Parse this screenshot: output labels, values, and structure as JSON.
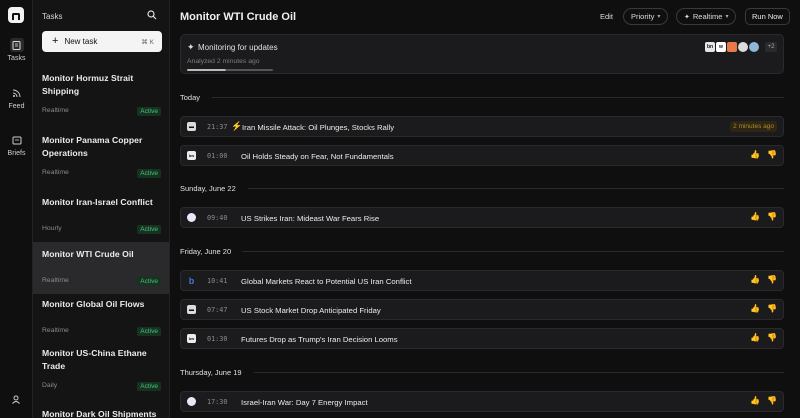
{
  "rail": {
    "items": [
      {
        "label": "Tasks",
        "icon": "clipboard-icon"
      },
      {
        "label": "Feed",
        "icon": "rss-icon"
      },
      {
        "label": "Briefs",
        "icon": "brief-icon"
      },
      {
        "label": "",
        "icon": "user-add-icon"
      }
    ]
  },
  "sidebar": {
    "header": "Tasks",
    "new_task": "New task",
    "shortcut": "⌘ K",
    "tasks": [
      {
        "title": "Monitor Hormuz Strait Shipping",
        "freq": "Realtime",
        "status": "Active"
      },
      {
        "title": "Monitor Panama Copper Operations",
        "freq": "Realtime",
        "status": "Active"
      },
      {
        "title": "Monitor Iran-Israel Conflict",
        "freq": "Hourly",
        "status": "Active"
      },
      {
        "title": "Monitor WTI Crude Oil",
        "freq": "Realtime",
        "status": "Active"
      },
      {
        "title": "Monitor Global Oil Flows",
        "freq": "Realtime",
        "status": "Active"
      },
      {
        "title": "Monitor US-China Ethane Trade",
        "freq": "Daily",
        "status": "Active"
      },
      {
        "title": "Monitor Dark Oil Shipments",
        "freq": "",
        "status": ""
      }
    ]
  },
  "header": {
    "title": "Monitor WTI Crude Oil",
    "edit": "Edit",
    "priority": "Priority",
    "realtime": "Realtime",
    "run_now": "Run Now"
  },
  "monitor": {
    "status": "Monitoring for updates",
    "sub": "Analyzed 2 minutes ago",
    "more": "+2",
    "progress": 0.45
  },
  "feed": {
    "today": "Today",
    "sun": "Sunday, June 22",
    "fri": "Friday, June 20",
    "thu": "Thursday, June 19",
    "rows": [
      {
        "time": "21:37",
        "title": "Iran Missile Attack: Oil Plunges, Stocks Rally",
        "tag": "2 minutes ago"
      },
      {
        "time": "01:00",
        "title": "Oil Holds Steady on Fear, Not Fundamentals"
      },
      {
        "time": "09:40",
        "title": "US Strikes Iran: Mideast War Fears Rise"
      },
      {
        "time": "10:41",
        "title": "Global Markets React to Potential US Iran Conflict"
      },
      {
        "time": "07:47",
        "title": "US Stock Market Drop Anticipated Friday"
      },
      {
        "time": "01:30",
        "title": "Futures Drop as Trump's Iran Decision Looms"
      },
      {
        "time": "17:30",
        "title": "Israel-Iran War: Day 7 Energy Impact"
      }
    ]
  }
}
